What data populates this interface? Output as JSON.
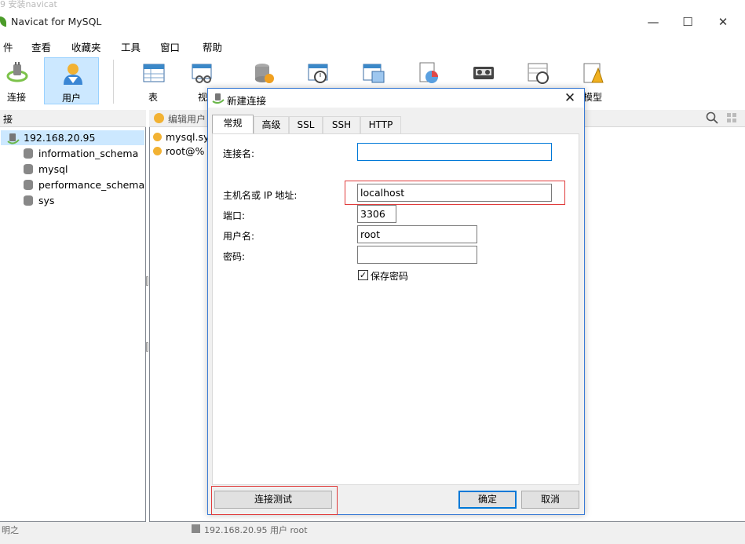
{
  "top_crop_text": "9 安装navicat",
  "window": {
    "title": "Navicat for MySQL",
    "minimize": "—",
    "maximize": "☐",
    "close": "✕"
  },
  "menu": [
    "件",
    "查看",
    "收藏夹",
    "工具",
    "窗口",
    "帮助"
  ],
  "toolbar": [
    {
      "label": "连接",
      "icon": "plug-icon"
    },
    {
      "label": "用户",
      "icon": "user-icon"
    },
    {
      "label": "表",
      "icon": "table-icon"
    },
    {
      "label": "视",
      "icon": "view-icon"
    },
    {
      "label": "",
      "icon": "function-icon"
    },
    {
      "label": "",
      "icon": "event-icon"
    },
    {
      "label": "",
      "icon": "query-icon"
    },
    {
      "label": "",
      "icon": "report-icon"
    },
    {
      "label": "",
      "icon": "backup-icon"
    },
    {
      "label": "",
      "icon": "schedule-icon"
    },
    {
      "label": "模型",
      "icon": "model-icon"
    }
  ],
  "left_panel": {
    "header": "接",
    "connection": "192.168.20.95",
    "databases": [
      "information_schema",
      "mysql",
      "performance_schema",
      "sys"
    ]
  },
  "mid_panel": {
    "edit_user": "编辑用户",
    "users": [
      "mysql.sys",
      "root@%"
    ]
  },
  "statusbar": {
    "left": "明之",
    "center": "192.168.20.95   用户   root"
  },
  "dialog": {
    "title": "新建连接",
    "close": "✕",
    "tabs": [
      "常规",
      "高级",
      "SSL",
      "SSH",
      "HTTP"
    ],
    "labels": {
      "connection_name": "连接名:",
      "host": "主机名或 IP 地址:",
      "port": "端口:",
      "username": "用户名:",
      "password": "密码:"
    },
    "values": {
      "connection_name": "",
      "host": "localhost",
      "port": "3306",
      "username": "root",
      "password": ""
    },
    "save_password": "保存密码",
    "save_password_checked": "✓",
    "test_button": "连接测试",
    "ok_button": "确定",
    "cancel_button": "取消"
  },
  "colors": {
    "accent": "#0078d7",
    "highlight_box": "#e03c3c",
    "active_tool": "#cce8ff"
  }
}
